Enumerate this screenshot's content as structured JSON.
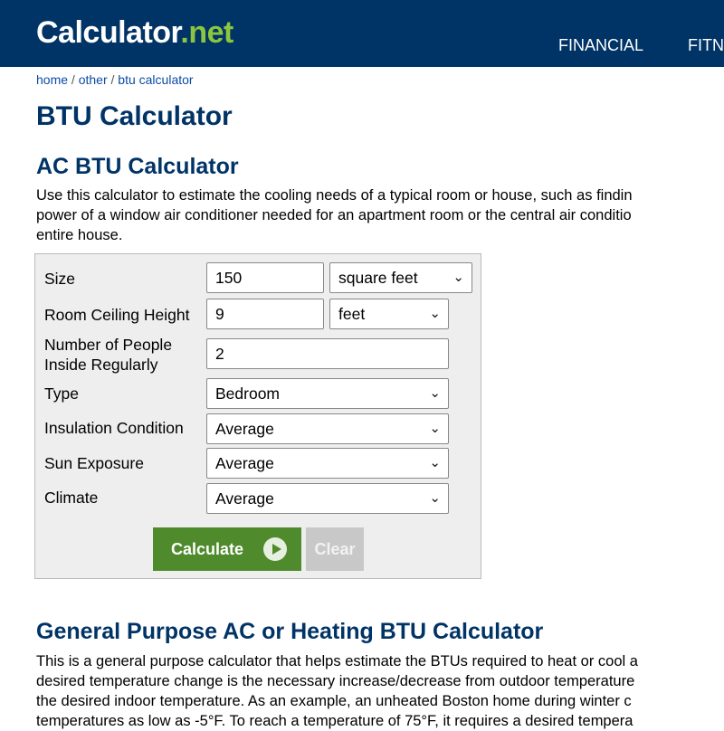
{
  "header": {
    "logo_main": "Calculator",
    "logo_dot": ".",
    "logo_net": "net",
    "nav": [
      "FINANCIAL",
      "FITN"
    ]
  },
  "breadcrumb": {
    "home": "home",
    "sep": " / ",
    "other": "other",
    "current": "btu calculator"
  },
  "page_title": "BTU Calculator",
  "ac_section": {
    "title": "AC BTU Calculator",
    "intro_lines": [
      "Use this calculator to estimate the cooling needs of a typical room or house, such as findin",
      "power of a window air conditioner needed for an apartment room or the central air conditio",
      "entire house."
    ]
  },
  "form": {
    "size": {
      "label": "Size",
      "value": "150",
      "unit": "square feet"
    },
    "ceiling": {
      "label": "Room Ceiling Height",
      "value": "9",
      "unit": "feet"
    },
    "people": {
      "label_line1": "Number of People",
      "label_line2": "Inside Regularly",
      "value": "2"
    },
    "type": {
      "label": "Type",
      "value": "Bedroom"
    },
    "insulation": {
      "label": "Insulation Condition",
      "value": "Average"
    },
    "sun": {
      "label": "Sun Exposure",
      "value": "Average"
    },
    "climate": {
      "label": "Climate",
      "value": "Average"
    },
    "calculate_label": "Calculate",
    "clear_label": "Clear"
  },
  "general_section": {
    "title": "General Purpose AC or Heating BTU Calculator",
    "body_lines": [
      "This is a general purpose calculator that helps estimate the BTUs required to heat or cool a",
      "desired temperature change is the necessary increase/decrease from outdoor temperature",
      "the desired indoor temperature. As an example, an unheated Boston home during winter c",
      "temperatures as low as -5°F. To reach a temperature of 75°F, it requires a desired tempera"
    ]
  },
  "colors": {
    "header_bg": "#003366",
    "accent_green": "#8cc63f",
    "button_green": "#4f8b2c",
    "title_blue": "#003366"
  }
}
